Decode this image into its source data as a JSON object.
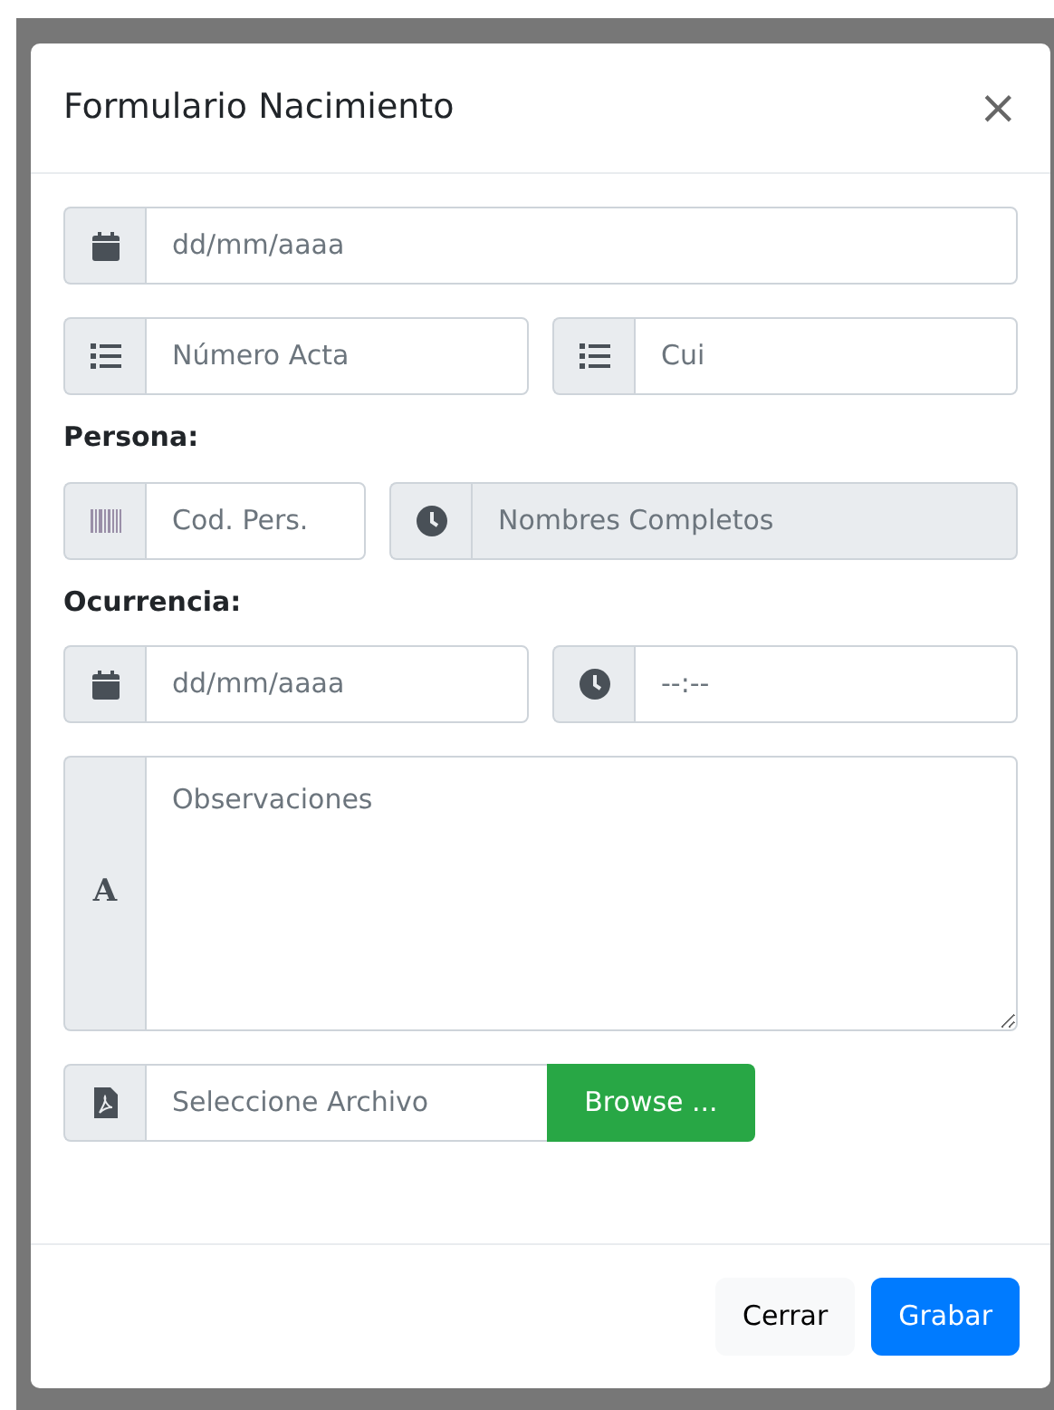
{
  "modal": {
    "title": "Formulario Nacimiento",
    "close": "×"
  },
  "groups": [
    {
      "fields": [
        {
          "kind": "date",
          "placeholder": "dd/mm/aaaa",
          "disabled": false
        }
      ]
    },
    {
      "fields": [
        {
          "kind": "number",
          "placeholder": "Número Acta",
          "disabled": false
        },
        {
          "kind": "number",
          "placeholder": "Cui",
          "disabled": false
        }
      ]
    },
    {
      "label": "Persona:",
      "fields": [
        {
          "kind": "code",
          "placeholder": "Cod. Pers.",
          "disabled": false
        },
        {
          "kind": "name",
          "placeholder": "Nombres Completos",
          "disabled": true
        }
      ]
    },
    {
      "label": "Ocurrencia:",
      "fields": [
        {
          "kind": "date",
          "placeholder": "dd/mm/aaaa",
          "disabled": false
        },
        {
          "kind": "time",
          "placeholder": "--:--",
          "disabled": false
        }
      ]
    },
    {
      "fields": [
        {
          "kind": "notes",
          "addon": "A",
          "placeholder": "Observaciones",
          "disabled": false
        }
      ]
    },
    {
      "fields": [
        {
          "kind": "file",
          "placeholder": "Seleccione Archivo",
          "button": "Browse ...",
          "disabled": false
        }
      ]
    }
  ],
  "footer": {
    "buttons": [
      {
        "kind": "secondary",
        "label": "Cerrar"
      },
      {
        "kind": "primary",
        "label": "Grabar"
      }
    ]
  }
}
